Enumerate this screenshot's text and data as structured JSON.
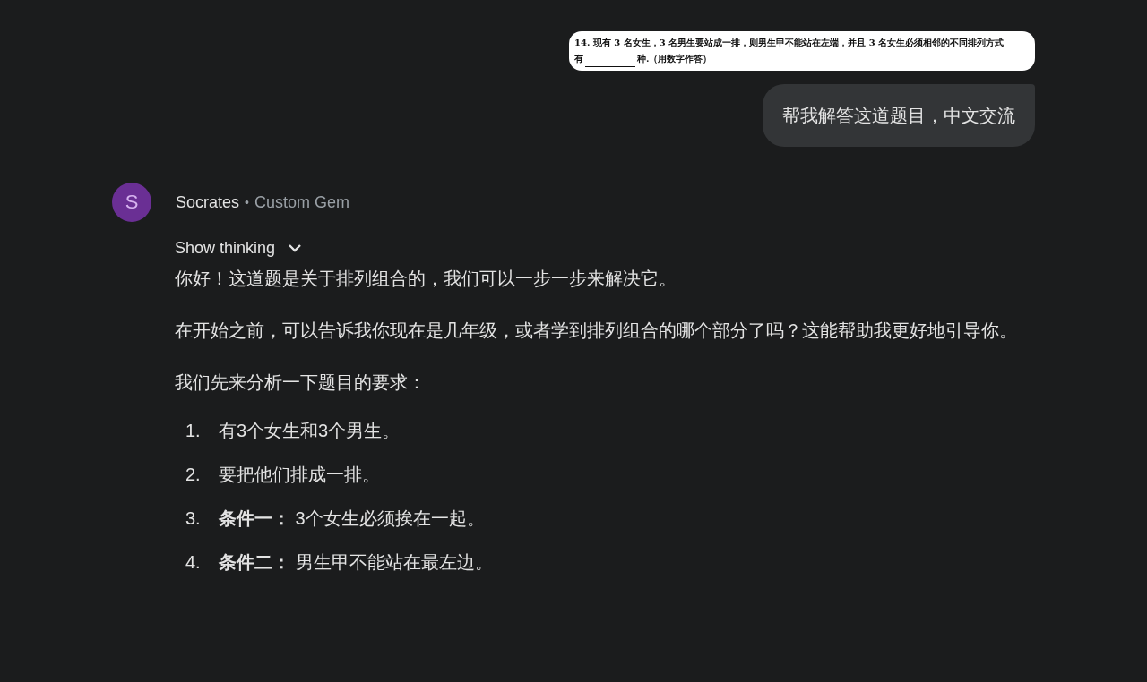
{
  "user_message": {
    "attachment": {
      "kind": "document",
      "line_1": "14. 现有 3 名女生，3 名男生要站成一排，则男生甲不能站在左端，并且 3 名女生必须相邻的不同排列方式",
      "line_2_before": "有",
      "line_2_after": "种.（用数字作答）"
    },
    "text": "帮我解答这道题目，中文交流"
  },
  "response": {
    "avatar": "S",
    "author": "Socrates",
    "separator": "•",
    "subtitle": "Custom Gem",
    "thinking_toggle": {
      "label": "Show thinking",
      "expanded": false
    },
    "paragraphs": [
      "你好！这道题是关于排列组合的，我们可以一步一步来解决它。",
      "在开始之前，可以告诉我你现在是几年级，或者学到排列组合的哪个部分了吗？这能帮助我更好地引导你。",
      "我们先来分析一下题目的要求："
    ],
    "list": [
      {
        "number": "1.",
        "text": "有3个女生和3个男生。"
      },
      {
        "number": "2.",
        "text": "要把他们排成一排。"
      },
      {
        "number": "3.",
        "text": "**条件一：** 3个女生必须挨在一起。"
      },
      {
        "number": "4.",
        "text": "**条件二：** 男生甲不能站在最左边。"
      }
    ]
  }
}
